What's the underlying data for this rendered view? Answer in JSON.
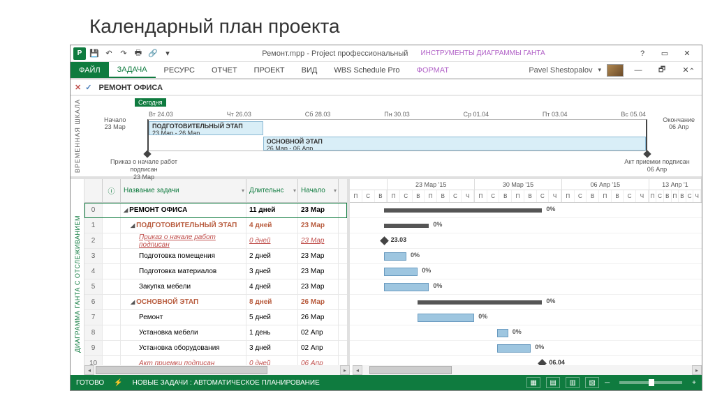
{
  "slide_title": "Календарный план проекта",
  "titlebar": {
    "doc": "Ремонт.mpp - Project профессиональный",
    "contextual": "ИНСТРУМЕНТЫ ДИАГРАММЫ ГАНТА",
    "user": "Pavel Shestopalov"
  },
  "ribbon": {
    "file": "ФАЙЛ",
    "tabs": [
      "ЗАДАЧА",
      "РЕСУРС",
      "ОТЧЕТ",
      "ПРОЕКТ",
      "ВИД",
      "WBS Schedule Pro"
    ],
    "format": "ФОРМАТ"
  },
  "formula": "РЕМОНТ ОФИСА",
  "timeline": {
    "vlabel": "ВРЕМЕННАЯ ШКАЛА",
    "today": "Сегодня",
    "start_label": "Начало",
    "start_date": "23 Мар",
    "end_label": "Окончание",
    "end_date": "06 Апр",
    "ticks": [
      "Вт 24.03",
      "Чт 26.03",
      "Сб 28.03",
      "Пн 30.03",
      "Ср 01.04",
      "Пт 03.04",
      "Вс 05.04"
    ],
    "bar1_title": "ПОДГОТОВИТЕЛЬНЫЙ ЭТАП",
    "bar1_dates": "23 Мар - 26 Мар",
    "bar2_title": "ОСНОВНОЙ ЭТАП",
    "bar2_dates": "26 Мар - 06 Апр",
    "ms1": "Приказ о начале работ подписан",
    "ms1_date": "23 Мар",
    "ms2": "Акт приемки подписан",
    "ms2_date": "06 Апр"
  },
  "gantt": {
    "vlabel": "ДИАГРАММА ГАНТА С ОТСЛЕЖИВАНИЕМ",
    "cols": {
      "info": "ⓘ",
      "name": "Название задачи",
      "dur": "Длительнс",
      "start": "Начало"
    },
    "weeks": [
      "23 Мар '15",
      "30 Мар '15",
      "06 Апр '15",
      "13 Апр '1"
    ],
    "days": [
      "П",
      "С",
      "В",
      "П",
      "В",
      "С",
      "Ч"
    ],
    "rows": [
      {
        "id": "0",
        "name": "РЕМОНТ ОФИСА",
        "dur": "11 дней",
        "start": "23 Мар",
        "type": "summary"
      },
      {
        "id": "1",
        "name": "ПОДГОТОВИТЕЛЬНЫЙ ЭТАП",
        "dur": "4 дней",
        "start": "23 Мар",
        "type": "subsum"
      },
      {
        "id": "2",
        "name": "Приказ о начале работ подписан",
        "dur": "0 дней",
        "start": "23 Мар",
        "type": "milestone"
      },
      {
        "id": "3",
        "name": "Подготовка помещения",
        "dur": "2 дней",
        "start": "23 Мар",
        "type": "task"
      },
      {
        "id": "4",
        "name": "Подготовка материалов",
        "dur": "3 дней",
        "start": "23 Мар",
        "type": "task"
      },
      {
        "id": "5",
        "name": "Закупка мебели",
        "dur": "4 дней",
        "start": "23 Мар",
        "type": "task"
      },
      {
        "id": "6",
        "name": "ОСНОВНОЙ ЭТАП",
        "dur": "8 дней",
        "start": "26 Мар",
        "type": "subsum"
      },
      {
        "id": "7",
        "name": "Ремонт",
        "dur": "5 дней",
        "start": "26 Мар",
        "type": "task"
      },
      {
        "id": "8",
        "name": "Установка мебели",
        "dur": "1 день",
        "start": "02 Апр",
        "type": "task"
      },
      {
        "id": "9",
        "name": "Установка оборудования",
        "dur": "3 дней",
        "start": "02 Апр",
        "type": "task"
      },
      {
        "id": "10",
        "name": "Акт приемки подписан",
        "dur": "0 дней",
        "start": "06 Апр",
        "type": "milestone"
      }
    ],
    "ms_labels": {
      "r2": "23.03",
      "r10": "06.04"
    },
    "pct": "0%"
  },
  "status": {
    "ready": "ГОТОВО",
    "newtasks": "НОВЫЕ ЗАДАЧИ : АВТОМАТИЧЕСКОЕ ПЛАНИРОВАНИЕ"
  },
  "chart_data": {
    "type": "gantt",
    "title": "РЕМОНТ ОФИСА",
    "start": "2015-03-23",
    "end": "2015-04-06",
    "tasks": [
      {
        "id": 0,
        "name": "РЕМОНТ ОФИСА",
        "start": "2015-03-23",
        "duration_days": 11,
        "type": "summary",
        "progress_pct": 0
      },
      {
        "id": 1,
        "name": "ПОДГОТОВИТЕЛЬНЫЙ ЭТАП",
        "start": "2015-03-23",
        "duration_days": 4,
        "type": "summary",
        "progress_pct": 0
      },
      {
        "id": 2,
        "name": "Приказ о начале работ подписан",
        "start": "2015-03-23",
        "duration_days": 0,
        "type": "milestone"
      },
      {
        "id": 3,
        "name": "Подготовка помещения",
        "start": "2015-03-23",
        "duration_days": 2,
        "type": "task",
        "progress_pct": 0
      },
      {
        "id": 4,
        "name": "Подготовка материалов",
        "start": "2015-03-23",
        "duration_days": 3,
        "type": "task",
        "progress_pct": 0
      },
      {
        "id": 5,
        "name": "Закупка мебели",
        "start": "2015-03-23",
        "duration_days": 4,
        "type": "task",
        "progress_pct": 0
      },
      {
        "id": 6,
        "name": "ОСНОВНОЙ ЭТАП",
        "start": "2015-03-26",
        "duration_days": 8,
        "type": "summary",
        "progress_pct": 0
      },
      {
        "id": 7,
        "name": "Ремонт",
        "start": "2015-03-26",
        "duration_days": 5,
        "type": "task",
        "progress_pct": 0
      },
      {
        "id": 8,
        "name": "Установка мебели",
        "start": "2015-04-02",
        "duration_days": 1,
        "type": "task",
        "progress_pct": 0
      },
      {
        "id": 9,
        "name": "Установка оборудования",
        "start": "2015-04-02",
        "duration_days": 3,
        "type": "task",
        "progress_pct": 0
      },
      {
        "id": 10,
        "name": "Акт приемки подписан",
        "start": "2015-04-06",
        "duration_days": 0,
        "type": "milestone"
      }
    ]
  }
}
